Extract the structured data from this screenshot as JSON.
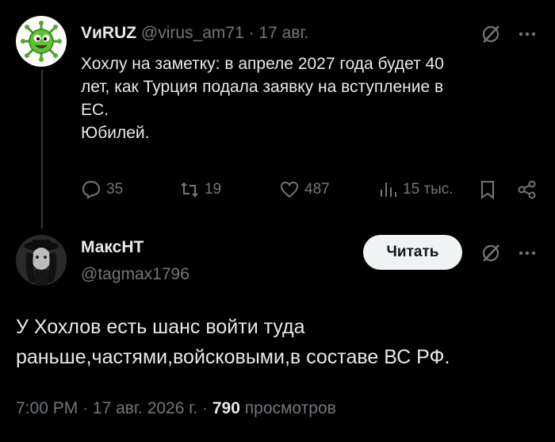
{
  "colors": {
    "background": "#000000",
    "text": "#e7e9ea",
    "muted": "#71767b",
    "avatar1_bg": "#ffffff",
    "virus_green": "#4caf2a"
  },
  "reply_tweet": {
    "author_name": "VиRUZ",
    "handle": "@virus_am71",
    "separator": "·",
    "date": "17 авг.",
    "text_lines": [
      "Хохлу на заметку: в апреле 2027 года будет 40",
      "лет, как Турция подала заявку на вступление в",
      "ЕС.",
      "Юбилей."
    ],
    "actions": {
      "replies": "35",
      "reposts": "19",
      "likes": "487",
      "views": "15 тыс."
    },
    "icons": [
      "grok-icon",
      "more-icon",
      "reply-icon",
      "repost-icon",
      "like-icon",
      "views-icon",
      "bookmark-icon",
      "share-icon"
    ]
  },
  "main_tweet": {
    "author_name": "МаксНТ",
    "handle": "@tagmax1796",
    "follow_label": "Читать",
    "text_lines": [
      "У Хохлов есть шанс войти туда",
      "раньше,частями,войсковыми,в составе ВС РФ."
    ],
    "time": "7:00 PM",
    "separator": "·",
    "date": "17 авг. 2026 г.",
    "separator2": "·",
    "views_count": "790",
    "views_label": "просмотров"
  }
}
